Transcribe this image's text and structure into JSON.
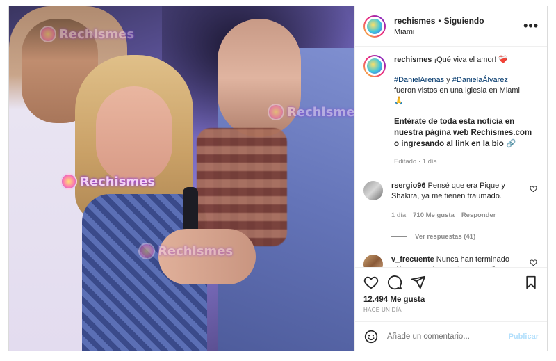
{
  "post": {
    "username": "rechismes",
    "dot": "•",
    "follow_status": "Siguiendo",
    "location": "Miami",
    "more_icon": "more-horizontal-icon",
    "watermark_text": "Rechismes"
  },
  "caption": {
    "username": "rechismes",
    "text": "¡Qué viva el amor! ❤️‍🩹",
    "tag1": "#DanielArenas",
    "joiner": " y ",
    "tag2": "#DanielaÁlvarez",
    "line2": "fueron vistos en una iglesia en Miami",
    "emoji": "🙏",
    "bold_text": "Entérate de toda esta noticia en nuestra página web Rechismes.com o ingresando al link en la bio 🔗",
    "meta": "Editado · 1 día"
  },
  "comments": [
    {
      "username": "rsergio96",
      "text": "Pensé que era Pique y Shakira, ya me tienen traumado.",
      "age": "1 día",
      "likes": "710 Me gusta",
      "reply": "Responder"
    },
    {
      "username": "v_frecuente",
      "text": "Nunca han terminado sólo que no les gusta compartir en"
    }
  ],
  "view_replies": "Ver respuestas (41)",
  "actions": {
    "likes": "12.494 Me gusta",
    "time": "HACE UN DÍA"
  },
  "compose": {
    "placeholder": "Añade un comentario...",
    "publish": "Publicar"
  },
  "colors": {
    "link": "#00376b",
    "muted": "#8e8e8e",
    "publish_disabled": "#b2dffc"
  }
}
